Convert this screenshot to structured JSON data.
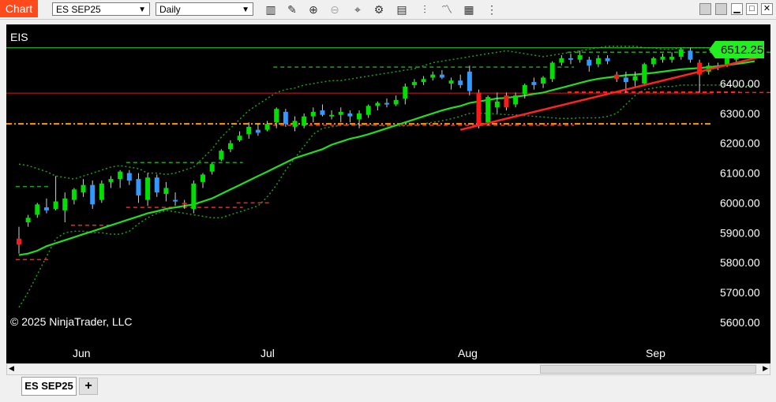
{
  "toolbar": {
    "chart_label": "Chart",
    "instrument": "ES SEP25",
    "interval": "Daily",
    "icons": [
      "bar-type-icon",
      "draw-pencil-icon",
      "zoom-in-icon",
      "zoom-out-icon",
      "crosshair-icon",
      "properties-icon",
      "data-box-icon",
      "indicators-icon",
      "strategies-icon",
      "template-icon",
      "more-icon"
    ]
  },
  "window": {
    "minimize": "▁",
    "maximize": "□",
    "close": "✕"
  },
  "chart": {
    "instrument_label": "EIS",
    "copyright": "© 2025 NinjaTrader, LLC",
    "last_price": "6512.25",
    "colors": {
      "up": "#00e000",
      "down": "#ff1a1a",
      "neutral": "#3399ff",
      "ma": "#22dd22",
      "bands": "#1fa01f",
      "trend": "#ff2222",
      "pivot_orange": "#ffa500"
    }
  },
  "chart_data": {
    "type": "candlestick",
    "y_ticks": [
      "6400.00",
      "6300.00",
      "6200.00",
      "6100.00",
      "6000.00",
      "5900.00",
      "5800.00",
      "5700.00",
      "5600.00"
    ],
    "x_ticks": [
      "Jun",
      "Jul",
      "Aug",
      "Sep"
    ],
    "candles": [
      {
        "o": 5880,
        "h": 5920,
        "l": 5830,
        "c": 5860,
        "col": "down"
      },
      {
        "o": 5935,
        "h": 5960,
        "l": 5920,
        "c": 5950,
        "col": "up"
      },
      {
        "o": 5960,
        "h": 6000,
        "l": 5950,
        "c": 5995,
        "col": "up"
      },
      {
        "o": 5975,
        "h": 6015,
        "l": 5965,
        "c": 5985,
        "col": "neutral"
      },
      {
        "o": 5980,
        "h": 6090,
        "l": 5975,
        "c": 6005,
        "col": "up"
      },
      {
        "o": 5975,
        "h": 6035,
        "l": 5935,
        "c": 6015,
        "col": "up"
      },
      {
        "o": 6010,
        "h": 6050,
        "l": 5995,
        "c": 6045,
        "col": "up"
      },
      {
        "o": 6035,
        "h": 6080,
        "l": 6020,
        "c": 6060,
        "col": "up"
      },
      {
        "o": 6060,
        "h": 6075,
        "l": 5980,
        "c": 5995,
        "col": "neutral"
      },
      {
        "o": 6010,
        "h": 6075,
        "l": 6000,
        "c": 6065,
        "col": "up"
      },
      {
        "o": 6070,
        "h": 6090,
        "l": 6050,
        "c": 6080,
        "col": "up"
      },
      {
        "o": 6080,
        "h": 6110,
        "l": 6050,
        "c": 6105,
        "col": "up"
      },
      {
        "o": 6100,
        "h": 6110,
        "l": 6060,
        "c": 6075,
        "col": "neutral"
      },
      {
        "o": 6080,
        "h": 6100,
        "l": 6000,
        "c": 6025,
        "col": "neutral"
      },
      {
        "o": 6010,
        "h": 6100,
        "l": 5990,
        "c": 6085,
        "col": "up"
      },
      {
        "o": 6085,
        "h": 6095,
        "l": 6020,
        "c": 6035,
        "col": "neutral"
      },
      {
        "o": 6030,
        "h": 6070,
        "l": 6005,
        "c": 6050,
        "col": "up"
      },
      {
        "o": 6010,
        "h": 6035,
        "l": 5990,
        "c": 6005,
        "col": "neutral"
      },
      {
        "o": 6000,
        "h": 6010,
        "l": 5980,
        "c": 5995,
        "col": "down"
      },
      {
        "o": 5980,
        "h": 6075,
        "l": 5965,
        "c": 6065,
        "col": "up"
      },
      {
        "o": 6070,
        "h": 6100,
        "l": 6050,
        "c": 6095,
        "col": "up"
      },
      {
        "o": 6105,
        "h": 6135,
        "l": 6095,
        "c": 6130,
        "col": "up"
      },
      {
        "o": 6145,
        "h": 6180,
        "l": 6140,
        "c": 6175,
        "col": "up"
      },
      {
        "o": 6180,
        "h": 6210,
        "l": 6170,
        "c": 6200,
        "col": "up"
      },
      {
        "o": 6210,
        "h": 6240,
        "l": 6205,
        "c": 6225,
        "col": "up"
      },
      {
        "o": 6230,
        "h": 6270,
        "l": 6215,
        "c": 6255,
        "col": "up"
      },
      {
        "o": 6245,
        "h": 6265,
        "l": 6225,
        "c": 6235,
        "col": "neutral"
      },
      {
        "o": 6245,
        "h": 6275,
        "l": 6240,
        "c": 6265,
        "col": "up"
      },
      {
        "o": 6270,
        "h": 6320,
        "l": 6250,
        "c": 6315,
        "col": "up"
      },
      {
        "o": 6305,
        "h": 6315,
        "l": 6255,
        "c": 6265,
        "col": "neutral"
      },
      {
        "o": 6255,
        "h": 6290,
        "l": 6240,
        "c": 6275,
        "col": "up"
      },
      {
        "o": 6260,
        "h": 6300,
        "l": 6250,
        "c": 6290,
        "col": "up"
      },
      {
        "o": 6290,
        "h": 6320,
        "l": 6270,
        "c": 6305,
        "col": "up"
      },
      {
        "o": 6310,
        "h": 6330,
        "l": 6290,
        "c": 6295,
        "col": "neutral"
      },
      {
        "o": 6290,
        "h": 6310,
        "l": 6280,
        "c": 6295,
        "col": "up"
      },
      {
        "o": 6295,
        "h": 6320,
        "l": 6270,
        "c": 6305,
        "col": "up"
      },
      {
        "o": 6300,
        "h": 6310,
        "l": 6270,
        "c": 6290,
        "col": "neutral"
      },
      {
        "o": 6280,
        "h": 6310,
        "l": 6250,
        "c": 6300,
        "col": "up"
      },
      {
        "o": 6295,
        "h": 6330,
        "l": 6285,
        "c": 6325,
        "col": "up"
      },
      {
        "o": 6325,
        "h": 6340,
        "l": 6310,
        "c": 6335,
        "col": "up"
      },
      {
        "o": 6335,
        "h": 6350,
        "l": 6320,
        "c": 6330,
        "col": "neutral"
      },
      {
        "o": 6330,
        "h": 6360,
        "l": 6325,
        "c": 6345,
        "col": "up"
      },
      {
        "o": 6350,
        "h": 6400,
        "l": 6330,
        "c": 6390,
        "col": "up"
      },
      {
        "o": 6395,
        "h": 6415,
        "l": 6385,
        "c": 6405,
        "col": "up"
      },
      {
        "o": 6405,
        "h": 6425,
        "l": 6395,
        "c": 6415,
        "col": "up"
      },
      {
        "o": 6420,
        "h": 6440,
        "l": 6410,
        "c": 6430,
        "col": "up"
      },
      {
        "o": 6430,
        "h": 6445,
        "l": 6415,
        "c": 6420,
        "col": "neutral"
      },
      {
        "o": 6400,
        "h": 6420,
        "l": 6380,
        "c": 6410,
        "col": "up"
      },
      {
        "o": 6410,
        "h": 6430,
        "l": 6385,
        "c": 6395,
        "col": "neutral"
      },
      {
        "o": 6375,
        "h": 6460,
        "l": 6360,
        "c": 6440,
        "col": "neutral"
      },
      {
        "o": 6370,
        "h": 6380,
        "l": 6250,
        "c": 6265,
        "col": "down"
      },
      {
        "o": 6270,
        "h": 6360,
        "l": 6260,
        "c": 6355,
        "col": "up"
      },
      {
        "o": 6320,
        "h": 6370,
        "l": 6300,
        "c": 6340,
        "col": "up"
      },
      {
        "o": 6360,
        "h": 6370,
        "l": 6310,
        "c": 6320,
        "col": "down"
      },
      {
        "o": 6330,
        "h": 6370,
        "l": 6320,
        "c": 6360,
        "col": "up"
      },
      {
        "o": 6365,
        "h": 6400,
        "l": 6350,
        "c": 6395,
        "col": "up"
      },
      {
        "o": 6395,
        "h": 6420,
        "l": 6380,
        "c": 6405,
        "col": "neutral"
      },
      {
        "o": 6400,
        "h": 6425,
        "l": 6385,
        "c": 6420,
        "col": "up"
      },
      {
        "o": 6415,
        "h": 6475,
        "l": 6405,
        "c": 6470,
        "col": "up"
      },
      {
        "o": 6470,
        "h": 6495,
        "l": 6460,
        "c": 6485,
        "col": "up"
      },
      {
        "o": 6485,
        "h": 6500,
        "l": 6465,
        "c": 6480,
        "col": "neutral"
      },
      {
        "o": 6480,
        "h": 6510,
        "l": 6470,
        "c": 6495,
        "col": "up"
      },
      {
        "o": 6480,
        "h": 6490,
        "l": 6440,
        "c": 6460,
        "col": "neutral"
      },
      {
        "o": 6465,
        "h": 6495,
        "l": 6455,
        "c": 6485,
        "col": "up"
      },
      {
        "o": 6485,
        "h": 6495,
        "l": 6465,
        "c": 6475,
        "col": "neutral"
      },
      {
        "o": 6430,
        "h": 6440,
        "l": 6405,
        "c": 6415,
        "col": "down"
      },
      {
        "o": 6420,
        "h": 6440,
        "l": 6370,
        "c": 6405,
        "col": "neutral"
      },
      {
        "o": 6410,
        "h": 6440,
        "l": 6385,
        "c": 6425,
        "col": "up"
      },
      {
        "o": 6400,
        "h": 6470,
        "l": 6395,
        "c": 6465,
        "col": "up"
      },
      {
        "o": 6465,
        "h": 6490,
        "l": 6455,
        "c": 6485,
        "col": "up"
      },
      {
        "o": 6480,
        "h": 6500,
        "l": 6470,
        "c": 6490,
        "col": "up"
      },
      {
        "o": 6490,
        "h": 6505,
        "l": 6470,
        "c": 6480,
        "col": "up"
      },
      {
        "o": 6490,
        "h": 6520,
        "l": 6480,
        "c": 6515,
        "col": "up"
      },
      {
        "o": 6510,
        "h": 6520,
        "l": 6470,
        "c": 6480,
        "col": "neutral"
      },
      {
        "o": 6470,
        "h": 6480,
        "l": 6370,
        "c": 6430,
        "col": "down"
      },
      {
        "o": 6440,
        "h": 6470,
        "l": 6430,
        "c": 6460,
        "col": "up"
      },
      {
        "o": 6460,
        "h": 6470,
        "l": 6445,
        "c": 6455,
        "col": "neutral"
      },
      {
        "o": 6460,
        "h": 6515,
        "l": 6455,
        "c": 6510,
        "col": "up"
      },
      {
        "o": 6480,
        "h": 6530,
        "l": 6470,
        "c": 6520,
        "col": "up"
      },
      {
        "o": 6495,
        "h": 6515,
        "l": 6490,
        "c": 6510,
        "col": "up"
      },
      {
        "o": 6510,
        "h": 6520,
        "l": 6505,
        "c": 6512.25,
        "col": "up"
      }
    ],
    "ma": [
      5825,
      5830,
      5840,
      5855,
      5865,
      5875,
      5885,
      5895,
      5905,
      5915,
      5925,
      5935,
      5945,
      5955,
      5965,
      5972,
      5980,
      5985,
      5990,
      5995,
      6005,
      6015,
      6030,
      6045,
      6060,
      6075,
      6090,
      6105,
      6120,
      6135,
      6150,
      6160,
      6170,
      6180,
      6195,
      6205,
      6215,
      6222,
      6230,
      6240,
      6250,
      6260,
      6270,
      6280,
      6290,
      6300,
      6310,
      6318,
      6325,
      6335,
      6340,
      6345,
      6350,
      6352,
      6356,
      6360,
      6365,
      6370,
      6378,
      6386,
      6394,
      6402,
      6410,
      6416,
      6420,
      6424,
      6428,
      6430,
      6433,
      6436,
      6440,
      6444,
      6448,
      6450,
      6452,
      6455,
      6458,
      6462,
      6466,
      6470,
      6475
    ],
    "upper_band": [
      6130,
      6125,
      6115,
      6105,
      6090,
      6085,
      6080,
      6090,
      6100,
      6110,
      6120,
      6125,
      6120,
      6115,
      6100,
      6100,
      6095,
      6100,
      6110,
      6120,
      6150,
      6180,
      6220,
      6250,
      6280,
      6310,
      6330,
      6350,
      6370,
      6380,
      6385,
      6395,
      6400,
      6405,
      6410,
      6410,
      6415,
      6420,
      6425,
      6430,
      6435,
      6440,
      6445,
      6450,
      6460,
      6470,
      6475,
      6480,
      6485,
      6490,
      6495,
      6500,
      6505,
      6510,
      6505,
      6500,
      6495,
      6490,
      6495,
      6500,
      6505,
      6510,
      6515,
      6520,
      6525,
      6525,
      6525,
      6525,
      6520,
      6520,
      6515,
      6515,
      6520,
      6520,
      6520,
      6520,
      6520,
      6525,
      6525,
      6530,
      6530
    ],
    "lower_band": [
      5650,
      5700,
      5760,
      5820,
      5880,
      5900,
      5905,
      5905,
      5900,
      5900,
      5895,
      5895,
      5905,
      5930,
      5950,
      5965,
      5975,
      5970,
      5965,
      5960,
      5955,
      5950,
      5950,
      5960,
      5970,
      5980,
      5990,
      6020,
      6060,
      6110,
      6150,
      6190,
      6230,
      6250,
      6255,
      6260,
      6262,
      6262,
      6262,
      6260,
      6258,
      6258,
      6258,
      6260,
      6265,
      6270,
      6275,
      6282,
      6290,
      6300,
      6300,
      6300,
      6298,
      6296,
      6295,
      6293,
      6290,
      6288,
      6285,
      6283,
      6283,
      6285,
      6285,
      6285,
      6290,
      6300,
      6330,
      6360,
      6380,
      6385,
      6390,
      6390,
      6395,
      6395,
      6395,
      6395,
      6395,
      6395,
      6393,
      6393,
      6393
    ],
    "hlines": [
      {
        "y": 6368,
        "color": "#e01818",
        "style": "solid"
      },
      {
        "y": 6520,
        "color": "#22cc22",
        "style": "solid"
      },
      {
        "y": 6265,
        "color": "#ff9900",
        "style": "dashdot"
      }
    ],
    "trendline": {
      "i0": 48,
      "y0": 6245,
      "i1": 80,
      "y1": 6490
    },
    "dashed_segments": [
      {
        "i0": 0,
        "i1": 3,
        "y": 5810,
        "color": "#ff2222"
      },
      {
        "i0": 0,
        "i1": 3,
        "y": 6055,
        "color": "#1fa01f"
      },
      {
        "i0": 6,
        "i1": 10,
        "y": 5925,
        "color": "#ff2222"
      },
      {
        "i0": 12,
        "i1": 24,
        "y": 6135,
        "color": "#1fa01f"
      },
      {
        "i0": 12,
        "i1": 24,
        "y": 5985,
        "color": "#ff2222"
      },
      {
        "i0": 24,
        "i1": 27,
        "y": 6000,
        "color": "#ff2222"
      },
      {
        "i0": 28,
        "i1": 60,
        "y": 6455,
        "color": "#1fa01f"
      },
      {
        "i0": 28,
        "i1": 60,
        "y": 6260,
        "color": "#ff2222"
      },
      {
        "i0": 60,
        "i1": 82,
        "y": 6505,
        "color": "#1fa01f"
      },
      {
        "i0": 60,
        "i1": 82,
        "y": 6370,
        "color": "#ff2222"
      },
      {
        "i0": 60,
        "i1": 78,
        "y": 6372,
        "color": "#ff2222"
      }
    ]
  }
}
